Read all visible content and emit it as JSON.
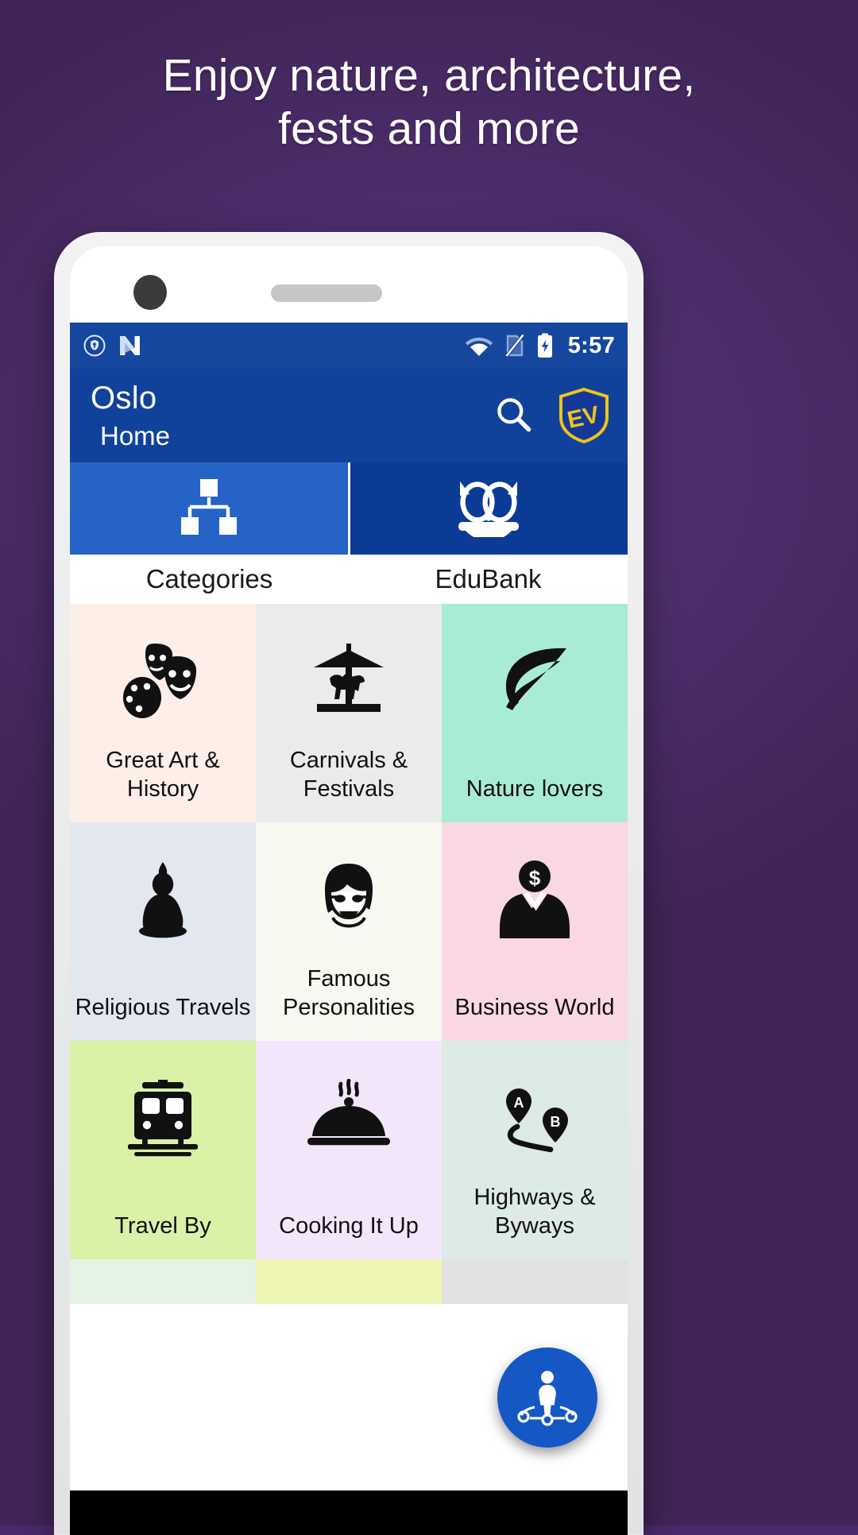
{
  "promo": {
    "headline_line1": "Enjoy nature, architecture,",
    "headline_line2": "fests and more",
    "background_color": "#4a2a6b",
    "headline_color": "#ffffff"
  },
  "statusbar": {
    "icons_left": [
      "vpn-shield-icon",
      "android-nougat-icon"
    ],
    "icons_right": [
      "wifi-icon",
      "no-sim-icon",
      "battery-charging-icon"
    ],
    "time": "5:57",
    "background_color": "#16479f"
  },
  "appbar": {
    "title": "Oslo",
    "subtitle": "Home",
    "search_icon": "search-icon",
    "logo_text": "EV",
    "logo_name": "ev-shield-logo",
    "background_color": "#11429b",
    "logo_color": "#f0c419"
  },
  "tabs": [
    {
      "label": "Categories",
      "icon": "sitemap-icon",
      "active": true,
      "color": "#2563c7"
    },
    {
      "label": "EduBank",
      "icon": "owl-icon",
      "active": false,
      "color": "#0c3b96"
    }
  ],
  "categories": [
    {
      "label": "Great Art & History",
      "icon": "theatre-masks-palette-icon",
      "bg": "#fdeee8"
    },
    {
      "label": "Carnivals & Festivals",
      "icon": "carousel-icon",
      "bg": "#ebebeb"
    },
    {
      "label": "Nature lovers",
      "icon": "leaf-icon",
      "bg": "#a9ecd4"
    },
    {
      "label": "Religious Travels",
      "icon": "buddha-icon",
      "bg": "#e3e7f0"
    },
    {
      "label": "Famous Personalities",
      "icon": "face-portrait-icon",
      "bg": "#f7f8f0"
    },
    {
      "label": "Business World",
      "icon": "businessman-dollar-icon",
      "bg": "#f9d7e3"
    },
    {
      "label": "Travel By",
      "icon": "train-icon",
      "bg": "#d9f2a8"
    },
    {
      "label": "Cooking It Up",
      "icon": "food-cloche-icon",
      "bg": "#f3e6fb"
    },
    {
      "label": "Highways & Byways",
      "icon": "route-map-icon",
      "bg": "#dcebe3"
    }
  ],
  "partial_row": [
    {
      "bg": "#e4f3e4"
    },
    {
      "bg": "#eef5b4"
    },
    {
      "bg": "#e2e2e2"
    }
  ],
  "fab": {
    "icon": "person-network-icon",
    "color": "#1558c4"
  }
}
